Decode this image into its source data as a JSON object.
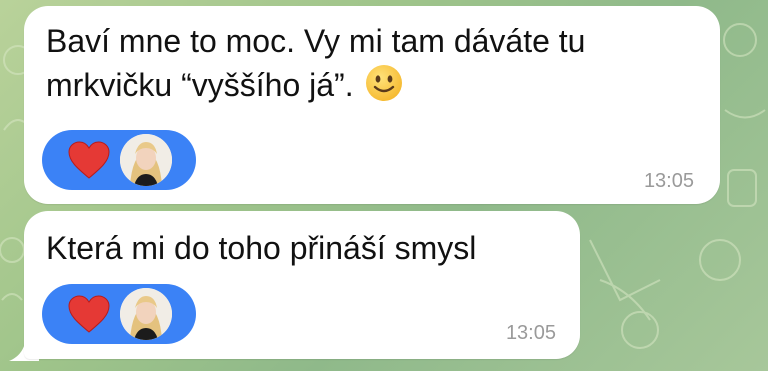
{
  "messages": [
    {
      "text": "Baví mne to moc. Vy mi tam dáváte tu mrkvičku “vyššího já”.",
      "emoji": "slightly-smiling-face-icon",
      "reaction": "heart-icon",
      "time": "13:05"
    },
    {
      "text": "Která mi do toho přináší smysl",
      "reaction": "heart-icon",
      "time": "13:05"
    }
  ],
  "colors": {
    "bubble": "#ffffff",
    "reaction_pill": "#3b82f6",
    "heart": "#e53935",
    "timestamp": "#9a9a9a",
    "wallpaper": "#a7c79a"
  }
}
